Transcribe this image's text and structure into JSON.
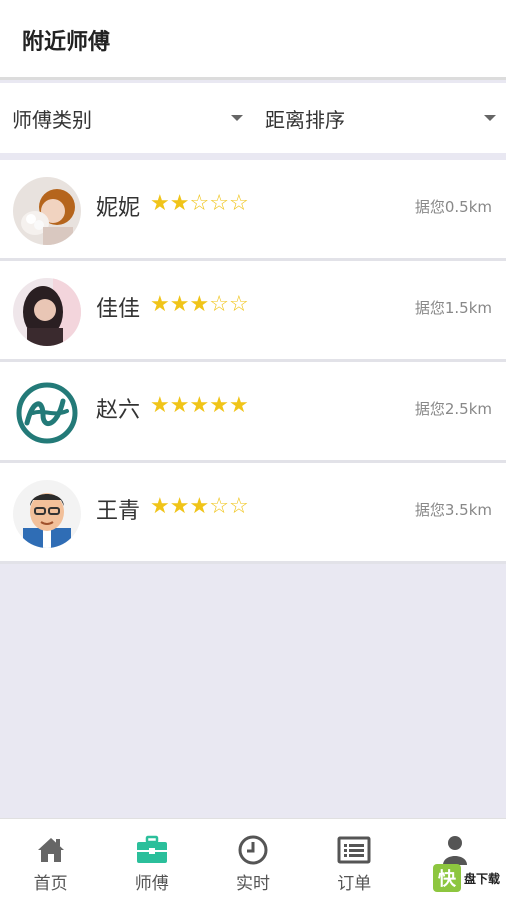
{
  "header": {
    "title": "附近师傅"
  },
  "filters": [
    {
      "label": "师傅类别"
    },
    {
      "label": "距离排序"
    }
  ],
  "masters": [
    {
      "name": "妮妮",
      "rating": 2,
      "max_rating": 5,
      "distance": "据您0.5km",
      "avatar": "avatar-photo-girl"
    },
    {
      "name": "佳佳",
      "rating": 3,
      "max_rating": 5,
      "distance": "据您1.5km",
      "avatar": "avatar-photo-girl-dark"
    },
    {
      "name": "赵六",
      "rating": 5,
      "max_rating": 5,
      "distance": "据您2.5km",
      "avatar": "avatar-logo-teal"
    },
    {
      "name": "王青",
      "rating": 3,
      "max_rating": 5,
      "distance": "据您3.5km",
      "avatar": "avatar-cartoon-man"
    }
  ],
  "tabbar": {
    "active": 1,
    "tabs": [
      {
        "label": "首页",
        "icon": "home-icon"
      },
      {
        "label": "师傅",
        "icon": "toolbox-icon"
      },
      {
        "label": "实时",
        "icon": "clock-icon"
      },
      {
        "label": "订单",
        "icon": "list-icon"
      },
      {
        "label": "",
        "icon": "user-icon"
      }
    ]
  },
  "watermark": {
    "text": "盘下载",
    "logo": "快"
  },
  "colors": {
    "accent": "#2bbf9b",
    "star": "#f0c419",
    "background": "#e9e8f2"
  }
}
